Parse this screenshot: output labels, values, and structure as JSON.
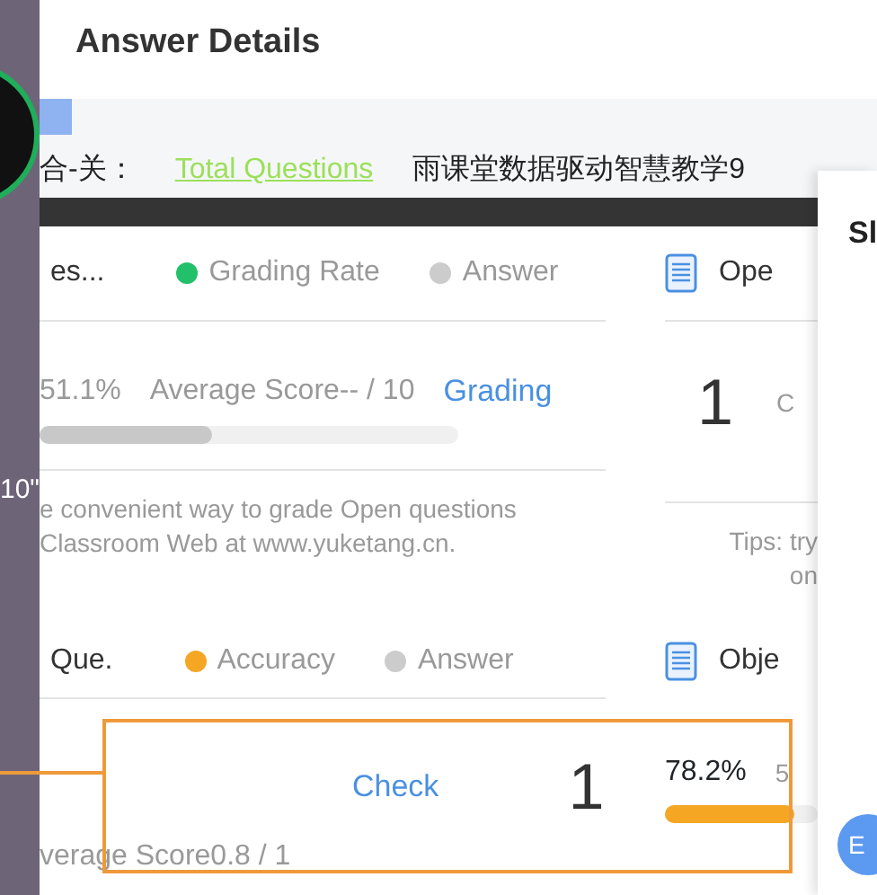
{
  "background": {
    "side_text": "10\""
  },
  "dialog": {
    "title": "Answer Details",
    "banner": [
      {
        "text": "合-关：",
        "kind": "plain"
      },
      {
        "text": "Total Questions",
        "kind": "highlight"
      },
      {
        "text": "雨课堂数据驱动智慧教学9",
        "kind": "plain"
      }
    ],
    "sections": [
      {
        "heading": "es...",
        "legend": [
          {
            "label": "Grading Rate",
            "color": "#22c06a"
          },
          {
            "label": "Answer",
            "color": "#cccccc"
          }
        ],
        "rate": "51.1%",
        "score": "Average Score-- / 10",
        "action": "Grading",
        "level": 0.41,
        "tips": [
          "e convenient way to grade Open questions",
          "Classroom Web at www.yuketang.cn."
        ],
        "side": {
          "title": "Ope",
          "count": "1",
          "extra": "C",
          "tips": [
            "Tips: try",
            "on"
          ]
        }
      },
      {
        "heading": "Que.",
        "legend": [
          {
            "label": "Accuracy",
            "color": "#f5a623"
          },
          {
            "label": "Answer",
            "color": "#cccccc"
          }
        ],
        "action": "Check",
        "count": "1",
        "score": "verage Score0.8 / 1",
        "highlighted": true,
        "side": {
          "title": "Obje",
          "rate": "78.2%",
          "extra": "5",
          "level": 0.85
        }
      }
    ]
  },
  "side_panel": {
    "title": "Sl",
    "button": "E"
  }
}
